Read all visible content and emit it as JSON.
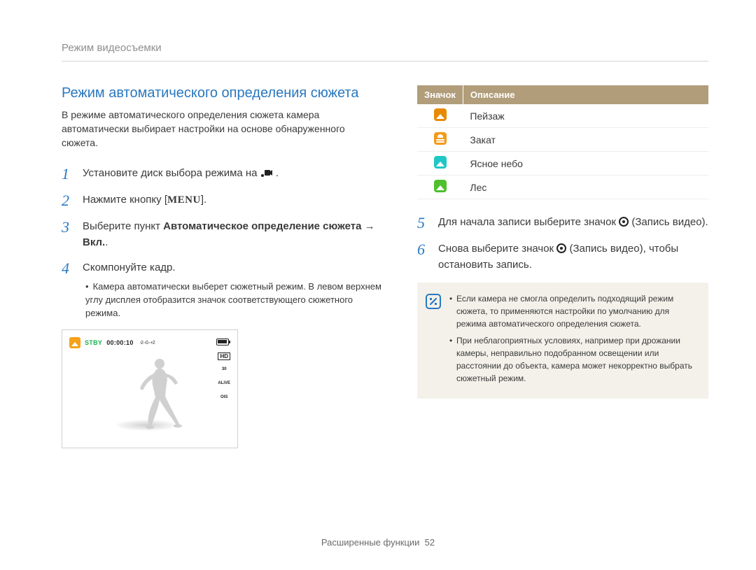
{
  "breadcrumb": "Режим видеосъемки",
  "left": {
    "heading": "Режим автоматического определения сюжета",
    "intro": "В режиме автоматического определения сюжета камера автоматически выбирает настройки на основе обнаруженного сюжета.",
    "steps": {
      "s1": {
        "num": "1",
        "text_pre": "Установите диск выбора режима на ",
        "text_post": " ."
      },
      "s2": {
        "num": "2",
        "text_pre": "Нажмите кнопку [",
        "menu": "MENU",
        "text_post": "]."
      },
      "s3": {
        "num": "3",
        "text_pre": "Выберите пункт ",
        "bold1": "Автоматическое определение сюжета",
        "arrow": " → ",
        "bold2": "Вкл.",
        "text_post": "."
      },
      "s4": {
        "num": "4",
        "text": "Скомпонуйте кадр.",
        "bullet": "Камера автоматически выберет сюжетный режим. В левом верхнем углу дисплея отобразится значок соответствующего сюжетного режима."
      }
    },
    "preview": {
      "stby": "STBY",
      "time": "00:00:10",
      "ev": "-2···0···+2",
      "hd": "HD",
      "b1": "30",
      "b2": "ALiVE",
      "b3": "OIS"
    }
  },
  "right": {
    "table": {
      "col_icon": "Значок",
      "col_desc": "Описание",
      "rows": {
        "r0": {
          "desc": "Пейзаж"
        },
        "r1": {
          "desc": "Закат"
        },
        "r2": {
          "desc": "Ясное небо"
        },
        "r3": {
          "desc": "Лес"
        }
      }
    },
    "steps": {
      "s5": {
        "num": "5",
        "pre": "Для начала записи выберите значок ",
        "post": " (Запись видео)."
      },
      "s6": {
        "num": "6",
        "pre": "Снова выберите значок ",
        "mid": " (Запись видео), чтобы остановить запись."
      }
    },
    "notes": {
      "n0": "Если камера не смогла определить подходящий режим сюжета, то применяются настройки по умолчанию для режима автоматического определения сюжета.",
      "n1": "При неблагоприятных условиях, например при дрожании камеры, неправильно подобранном освещении или расстоянии до объекта, камера может некорректно выбрать сюжетный режим."
    }
  },
  "footer": {
    "label": "Расширенные функции",
    "page": "52"
  }
}
